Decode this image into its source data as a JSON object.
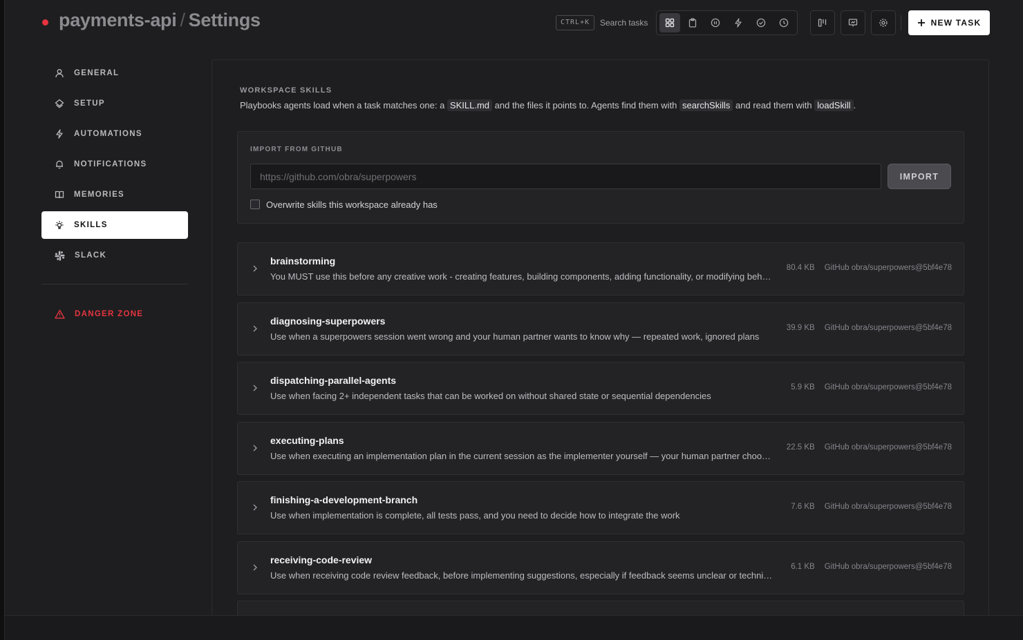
{
  "header": {
    "project": "payments-api",
    "separator": "/",
    "page": "Settings",
    "shortcut": "CTRL+K",
    "search_label": "Search tasks",
    "new_task_label": "NEW TASK"
  },
  "colors": {
    "accent_red": "#e5343f",
    "background": "#1e1e20",
    "active_nav_bg": "#ffffff"
  },
  "view_icons": [
    "grid-icon",
    "clipboard-icon",
    "pause-circle-icon",
    "bolt-icon",
    "check-circle-icon",
    "clock-icon"
  ],
  "sidebar": {
    "items": [
      {
        "label": "GENERAL",
        "icon": "user-icon"
      },
      {
        "label": "SETUP",
        "icon": "layers-icon"
      },
      {
        "label": "AUTOMATIONS",
        "icon": "bolt-icon"
      },
      {
        "label": "NOTIFICATIONS",
        "icon": "bell-icon"
      },
      {
        "label": "MEMORIES",
        "icon": "book-icon"
      },
      {
        "label": "SKILLS",
        "icon": "lightbulb-icon",
        "active": true
      },
      {
        "label": "SLACK",
        "icon": "slack-icon"
      }
    ],
    "danger": {
      "label": "DANGER ZONE",
      "icon": "warning-icon"
    }
  },
  "main": {
    "section_label": "WORKSPACE SKILLS",
    "desc_1": "Playbooks agents load when a task matches one: a",
    "code_1": "SKILL.md",
    "desc_2": "and the files it points to. Agents find them with",
    "code_2": "searchSkills",
    "desc_3": "and read them with",
    "code_3": "loadSkill",
    "desc_4": ".",
    "import": {
      "label": "IMPORT FROM GITHUB",
      "placeholder": "https://github.com/obra/superpowers",
      "value": "",
      "button": "IMPORT",
      "overwrite_label": "Overwrite skills this workspace already has",
      "overwrite_checked": false
    },
    "skills": [
      {
        "name": "brainstorming",
        "description": "You MUST use this before any creative work - creating features, building components, adding functionality, or modifying behavior",
        "size": "80.4 KB",
        "source": "GitHub obra/superpowers@5bf4e78"
      },
      {
        "name": "diagnosing-superpowers",
        "description": "Use when a superpowers session went wrong and your human partner wants to know why — repeated work, ignored plans",
        "size": "39.9 KB",
        "source": "GitHub obra/superpowers@5bf4e78"
      },
      {
        "name": "dispatching-parallel-agents",
        "description": "Use when facing 2+ independent tasks that can be worked on without shared state or sequential dependencies",
        "size": "5.9 KB",
        "source": "GitHub obra/superpowers@5bf4e78"
      },
      {
        "name": "executing-plans",
        "description": "Use when executing an implementation plan in the current session as the implementer yourself — your human partner chooses",
        "size": "22.5 KB",
        "source": "GitHub obra/superpowers@5bf4e78"
      },
      {
        "name": "finishing-a-development-branch",
        "description": "Use when implementation is complete, all tests pass, and you need to decide how to integrate the work",
        "size": "7.6 KB",
        "source": "GitHub obra/superpowers@5bf4e78"
      },
      {
        "name": "receiving-code-review",
        "description": "Use when receiving code review feedback, before implementing suggestions, especially if feedback seems unclear or technically questionable",
        "size": "6.1 KB",
        "source": "GitHub obra/superpowers@5bf4e78"
      }
    ]
  }
}
